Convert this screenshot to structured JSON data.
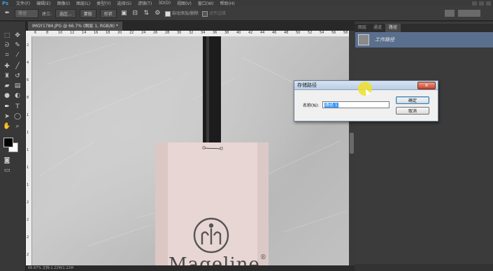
{
  "app": {
    "logo": "Ps",
    "menu": [
      "文件(F)",
      "编辑(E)",
      "图像(I)",
      "图层(L)",
      "类型(Y)",
      "选择(S)",
      "滤镜(T)",
      "3D(D)",
      "视图(V)",
      "窗口(W)",
      "帮助(H)"
    ]
  },
  "options_bar": {
    "tool_icon": "pen-icon",
    "mode_value": "路径",
    "make_label": "建立:",
    "selection_button": "选区...",
    "mask_button": "蒙版",
    "shape_button": "形状",
    "auto_add_delete_label": "自动添加/删除",
    "align_edges_label": "对齐边缘"
  },
  "document": {
    "tab_title": "IMGY1784.JPG @ 66.7% (图层 1, RGB/8) *",
    "ruler_top": [
      "6",
      "8",
      "10",
      "12",
      "14",
      "16",
      "18",
      "20",
      "22",
      "24",
      "26",
      "28",
      "30",
      "32",
      "34",
      "36",
      "38",
      "40",
      "42",
      "44",
      "46",
      "48",
      "50",
      "52",
      "54",
      "56",
      "58"
    ],
    "ruler_left": [
      "2",
      "4",
      "6",
      "8",
      "1",
      "1",
      "1",
      "1",
      "1",
      "2",
      "2",
      "2",
      "2"
    ],
    "status_text": "66.67%    文档:1.22M/1.22M",
    "product_text": "Mageline",
    "registered_mark": "®"
  },
  "panel": {
    "tabs": [
      "图层",
      "通道",
      "路径"
    ],
    "active_tab": 2,
    "path_item": "工作路径"
  },
  "dialog": {
    "title": "存储路径",
    "name_label": "名称(N):",
    "name_value": "路径 1",
    "ok_label": "确定",
    "cancel_label": "取消",
    "close_label": "x"
  },
  "colors": {
    "accent": "#3aa0e8",
    "path_row_selected": "#5a6f8e",
    "foreground": "#000000",
    "background": "#ffffff"
  }
}
